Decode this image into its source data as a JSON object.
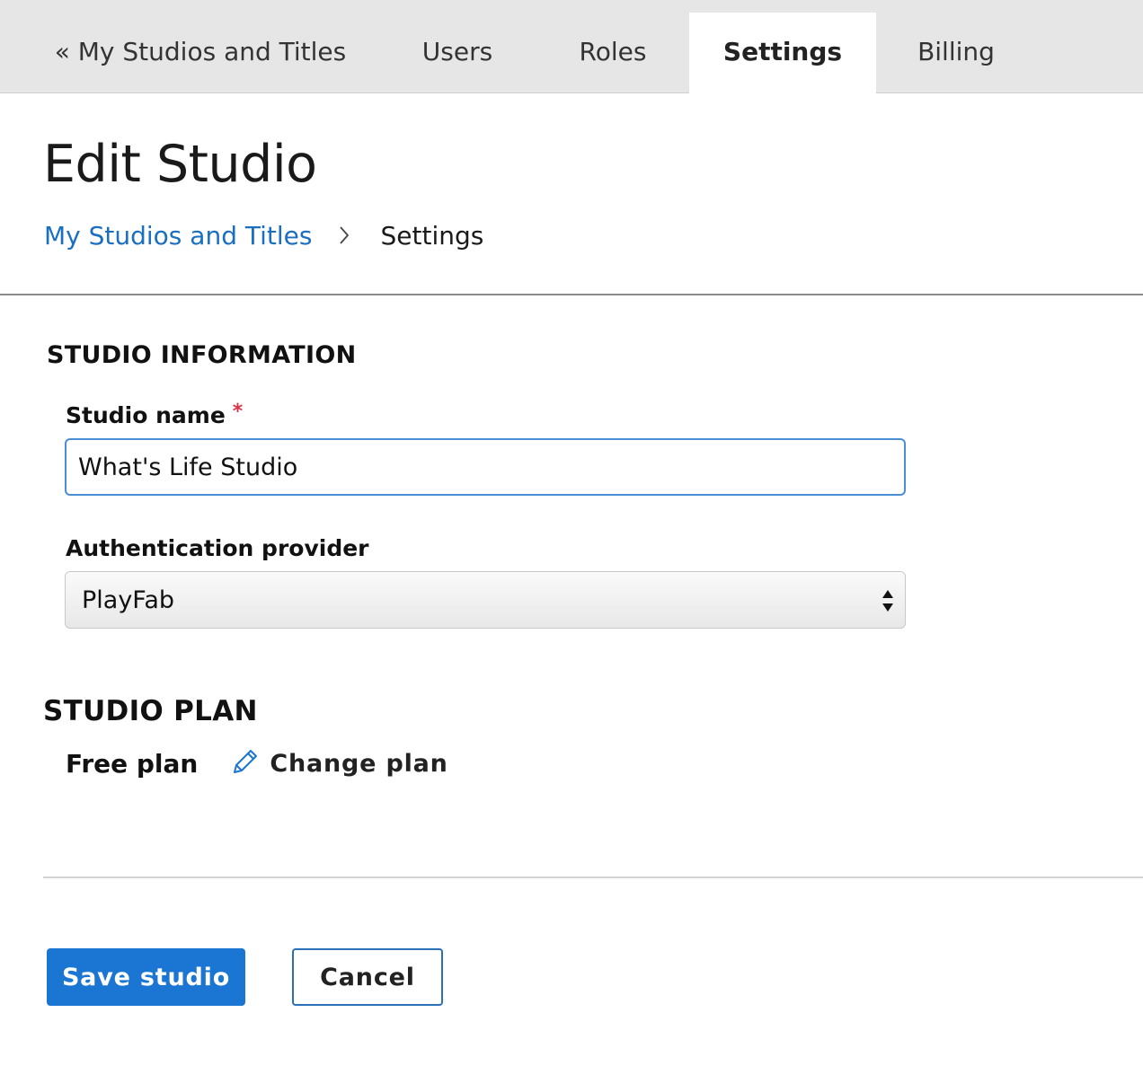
{
  "tabs": [
    {
      "label": "« My Studios and Titles"
    },
    {
      "label": "Users"
    },
    {
      "label": "Roles"
    },
    {
      "label": "Settings",
      "active": true
    },
    {
      "label": "Billing"
    }
  ],
  "page": {
    "title": "Edit Studio"
  },
  "breadcrumb": {
    "parent": "My Studios and Titles",
    "current": "Settings"
  },
  "studio_information": {
    "heading": "STUDIO INFORMATION",
    "name_label": "Studio name",
    "required_mark": "*",
    "name_value": "What's Life Studio",
    "auth_label": "Authentication provider",
    "auth_selected": "PlayFab"
  },
  "studio_plan": {
    "heading": "STUDIO PLAN",
    "plan_name": "Free plan",
    "change_label": "Change plan"
  },
  "actions": {
    "save_label": "Save studio",
    "cancel_label": "Cancel"
  },
  "colors": {
    "accent": "#1a76d2",
    "link": "#1a6fc1",
    "required": "#d6334a",
    "tab_bar": "#e6e6e6"
  }
}
